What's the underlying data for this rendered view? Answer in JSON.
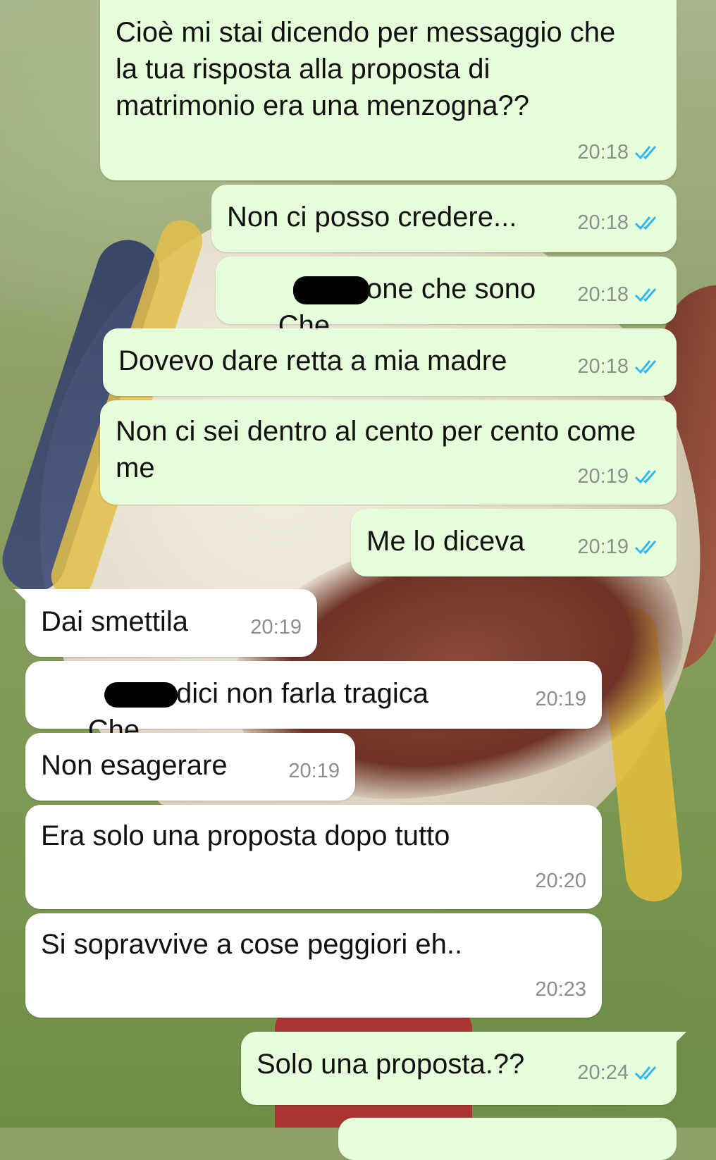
{
  "messages": [
    {
      "direction": "outgoing",
      "text": "Cioè mi stai dicendo per messaggio che la tua risposta alla proposta di matrimonio era una menzogna??",
      "time": "20:18",
      "read": true
    },
    {
      "direction": "outgoing",
      "text": "Non ci posso credere...",
      "time": "20:18",
      "read": true
    },
    {
      "direction": "outgoing",
      "text_before": "Che",
      "text_after": "one che sono",
      "redacted": true,
      "time": "20:18",
      "read": true
    },
    {
      "direction": "outgoing",
      "text": "Dovevo dare retta a mia madre",
      "time": "20:18",
      "read": true
    },
    {
      "direction": "outgoing",
      "text": "Non ci sei dentro al cento per cento come me",
      "time": "20:19",
      "read": true
    },
    {
      "direction": "outgoing",
      "text": "Me lo diceva",
      "time": "20:19",
      "read": true
    },
    {
      "direction": "incoming",
      "text": "Dai smettila",
      "time": "20:19"
    },
    {
      "direction": "incoming",
      "text_before": "Che",
      "text_after": "dici non farla tragica",
      "redacted": true,
      "time": "20:19"
    },
    {
      "direction": "incoming",
      "text": "Non esagerare",
      "time": "20:19"
    },
    {
      "direction": "incoming",
      "text": "Era solo una proposta dopo tutto",
      "time": "20:20"
    },
    {
      "direction": "incoming",
      "text": "Si sopravvive a cose peggiori eh..",
      "time": "20:23"
    },
    {
      "direction": "outgoing",
      "text": "Solo una proposta.??",
      "time": "20:24",
      "read": true
    }
  ],
  "colors": {
    "outgoing_bubble": "#e6ffda",
    "incoming_bubble": "#ffffff",
    "read_ticks": "#34b7f1",
    "timestamp": "#8a8f8a"
  },
  "icons": {
    "read_receipt": "double-check-icon"
  }
}
